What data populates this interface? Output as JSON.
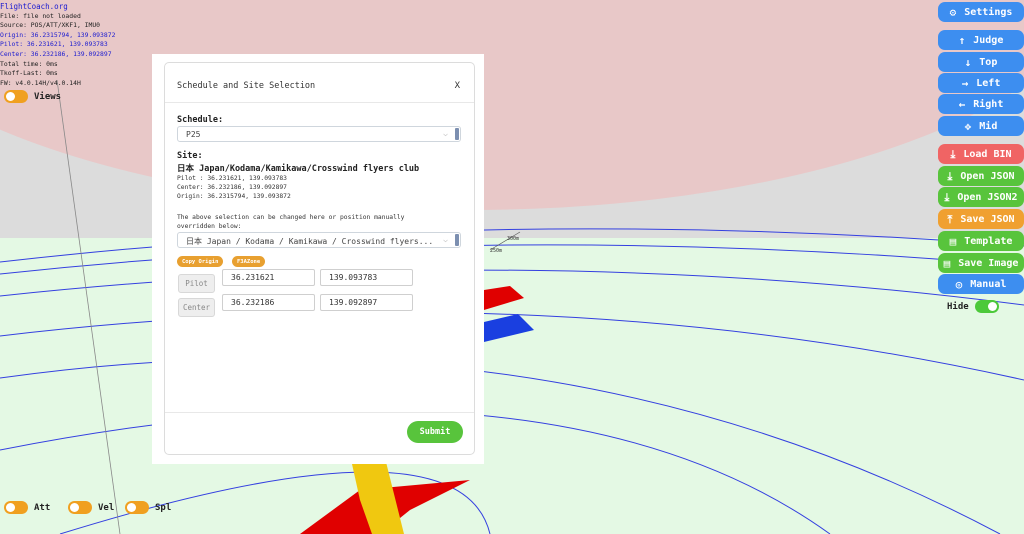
{
  "info": {
    "title": "FlightCoach.org",
    "lines": [
      "File: file not loaded",
      "Source: POS/ATT/XKF1, IMU0",
      "Origin: 36.2315794, 139.093872",
      "Pilot: 36.231621, 139.093783",
      "Center: 36.232186, 139.092897",
      "Total time: 0ms",
      "Tkoff-Last: 0ms",
      "FW: v4.0.14H/v4.0.14H"
    ]
  },
  "toggles": {
    "views": "Views",
    "att": "Att",
    "vel": "Vel",
    "spl": "Spl",
    "hide": "Hide"
  },
  "buttons": {
    "settings": "Settings",
    "judge": "Judge",
    "top": "Top",
    "left": "Left",
    "right": "Right",
    "mid": "Mid",
    "load_bin": "Load BIN",
    "open_json": "Open JSON",
    "open_json2": "Open JSON2",
    "save_json": "Save JSON",
    "template": "Template",
    "save_image": "Save Image",
    "manual": "Manual"
  },
  "scene_labels": {
    "dist_300": "300m",
    "dist_250": "250m"
  },
  "modal": {
    "title": "Schedule and Site Selection",
    "close": "X",
    "schedule_label": "Schedule:",
    "schedule_value": "P25",
    "site_label": "Site:",
    "site_name": "日本 Japan/Kodama/Kamikawa/Crosswind flyers club",
    "pilot_line": "Pilot : 36.231621, 139.093783",
    "center_line": "Center: 36.232186, 139.092897",
    "origin_line": "Origin: 36.2315794, 139.093872",
    "note": "The above selection can be changed here or position manually overridden below:",
    "site_select_value": "日本 Japan / Kodama / Kamikawa / Crosswind flyers...",
    "copy_origin": "Copy Origin",
    "f3azone": "F3AZone",
    "pilot_btn": "Pilot",
    "center_btn": "Center",
    "pilot_lat": "36.231621",
    "pilot_lon": "139.093783",
    "center_lat": "36.232186",
    "center_lon": "139.092897",
    "submit": "Submit"
  },
  "colors": {
    "ground": "#e4f9e4",
    "sky_top": "#e8c8c8",
    "arc": "#3440e0",
    "button_blue": "#3d8ef0",
    "button_green": "#58c43c",
    "button_red": "#f06464",
    "button_orange": "#f0a030"
  }
}
